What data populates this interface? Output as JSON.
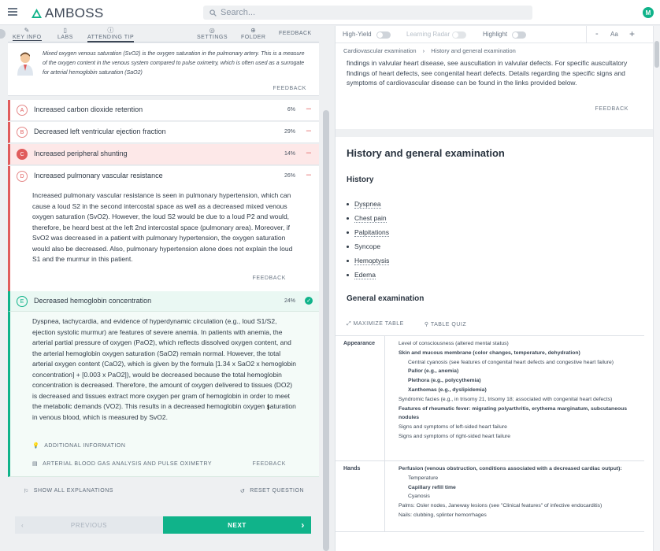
{
  "header": {
    "brand": "AMBOSS",
    "search_placeholder": "Search...",
    "avatar_letter": "M"
  },
  "toolbar": {
    "key_info": "KEY INFO",
    "labs": "LABS",
    "attending_tip": "ATTENDING TIP",
    "settings": "SETTINGS",
    "folder": "FOLDER",
    "feedback": "FEEDBACK"
  },
  "tip": {
    "text": "Mixed oxygen venous saturation (SvO2) is the oxygen saturation in the pulmonary artery. This is a measure of the oxygen content in the venous system compared to pulse oximetry, which is often used as a surrogate for arterial hemoglobin saturation (SaO2)",
    "feedback": "FEEDBACK"
  },
  "answers": [
    {
      "letter": "A",
      "text": "Increased carbon dioxide retention",
      "pct": "6%"
    },
    {
      "letter": "B",
      "text": "Decreased left ventricular ejection fraction",
      "pct": "29%"
    },
    {
      "letter": "C",
      "text": "Increased peripheral shunting",
      "pct": "14%"
    },
    {
      "letter": "D",
      "text": "Increased pulmonary vascular resistance",
      "pct": "26%"
    },
    {
      "letter": "E",
      "text": "Decreased hemoglobin concentration",
      "pct": "24%"
    }
  ],
  "explanation_d": {
    "text": "Increased pulmonary vascular resistance is seen in pulmonary hypertension, which can cause a loud S2 in the second intercostal space as well as a decreased mixed venous oxygen saturation (SvO2). However, the loud S2 would be due to a loud P2 and would, therefore, be heard best at the left 2nd intercostal space (pulmonary area). Moreover, if SvO2 was decreased in a patient with pulmonary hypertension, the oxygen saturation would also be decreased. Also, pulmonary hypertension alone does not explain the loud S1 and the murmur in this patient.",
    "feedback": "FEEDBACK"
  },
  "explanation_e": {
    "text": "Dyspnea, tachycardia, and evidence of hyperdynamic circulation (e.g., loud S1/S2, ejection systolic murmur) are features of severe anemia. In patients with anemia, the arterial partial pressure of oxygen (PaO2), which reflects dissolved oxygen content, and the arterial hemoglobin oxygen saturation (SaO2) remain normal. However, the total arterial oxygen content (CaO2), which is given by the formula [1.34 x SaO2 x hemoglobin concentration] + [0.003 x PaO2]), would be decreased because the total hemoglobin concentration is decreased. Therefore, the amount of oxygen delivered to tissues (DO2) is decreased and tissues extract more oxygen per gram of hemoglobin in order to meet the metabolic demands (VO2). This results in a decreased hemoglobin oxygen saturation in venous blood, which is measured by SvO2.",
    "additional": "ADDITIONAL INFORMATION",
    "abg": "ARTERIAL BLOOD GAS ANALYSIS AND PULSE OXIMETRY",
    "feedback": "FEEDBACK"
  },
  "actions": {
    "show_all": "SHOW ALL EXPLANATIONS",
    "reset": "RESET QUESTION"
  },
  "nav": {
    "previous": "PREVIOUS",
    "next": "NEXT"
  },
  "right": {
    "high_yield": "High-Yield",
    "learning_radar": "Learning Radar",
    "highlight": "Highlight",
    "font_label": "Aa",
    "breadcrumb": [
      "Cardiovascular examination",
      "History and general examination"
    ],
    "intro": "findings in valvular heart disease, see auscultation in valvular defects. For specific auscultatory findings of heart defects, see congenital heart defects. Details regarding the specific signs and symptoms of cardiovascular disease can be found in the links provided below.",
    "feedback": "FEEDBACK",
    "section_title": "History and general examination",
    "history_title": "History",
    "history": [
      "Dyspnea",
      "Chest pain",
      "Palpitations",
      "Syncope",
      "Hemoptysis",
      "Edema"
    ],
    "exam_title": "General examination",
    "maximize": "MAXIMIZE TABLE",
    "table_quiz": "TABLE QUIZ",
    "table": [
      {
        "label": "Appearance",
        "items": [
          "Level of consciousness (altered mental status)",
          "Skin and mucous membrane (color changes, temperature, dehydration)",
          "Central cyanosis (see features of congenital heart defects and congestive heart failure)",
          "Pallor (e.g., anemia)",
          "Plethora (e.g., polycythemia)",
          "Xanthomas (e.g., dyslipidemia)",
          "Syndromic facies (e.g., in trisomy 21, trisomy 18; associated with congenital heart defects)",
          "Features of rheumatic fever: migrating polyarthritis, erythema marginatum, subcutaneous nodules",
          "Signs and symptoms of left-sided heart failure",
          "Signs and symptoms of right-sided heart failure"
        ]
      },
      {
        "label": "Hands",
        "items": [
          "Perfusion (venous obstruction, conditions associated with a decreased cardiac output):",
          "Temperature",
          "Capillary refill time",
          "Cyanosis",
          "Palms: Osler nodes, Janeway lesions (see \"Clinical features\" of infective endocarditis)",
          "Nails: clubbing, splinter hemorrhages"
        ]
      }
    ]
  },
  "colors": {
    "accent": "#10b38a",
    "wrong": "#e05c5c",
    "selected_bg": "#fde8e8",
    "correct_bg": "#eaf8f3"
  }
}
